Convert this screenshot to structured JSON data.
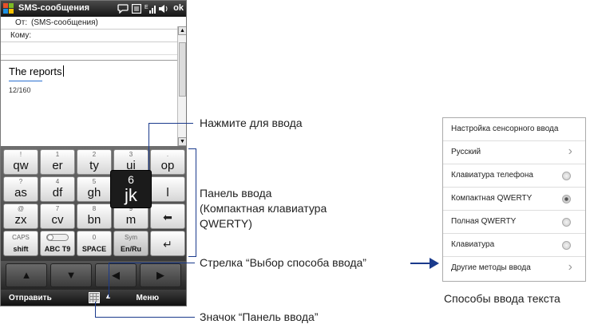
{
  "titlebar": {
    "title": "SMS-сообщения",
    "ok": "ok",
    "icons": [
      "windows-logo",
      "chat-icon",
      "contact-card-icon",
      "signal-icon",
      "speaker-icon"
    ]
  },
  "message": {
    "from_label": "От:",
    "from_value": "(SMS-сообщения)",
    "to_label": "Кому:",
    "to_value": "",
    "body": "The reports",
    "counter": "12/160"
  },
  "keyboard": {
    "row1": [
      {
        "top": "!",
        "main": "qw"
      },
      {
        "top": "1",
        "main": "er"
      },
      {
        "top": "2",
        "main": "ty"
      },
      {
        "top": "3",
        "main": "ui"
      },
      {
        "top": ".",
        "main": "op"
      }
    ],
    "row2": [
      {
        "top": "?",
        "main": "as"
      },
      {
        "top": "4",
        "main": "df"
      },
      {
        "top": "5",
        "main": "gh"
      },
      {
        "top": "",
        "main": "l"
      }
    ],
    "active_key": {
      "top": "6",
      "main": "jk"
    },
    "row3": [
      {
        "top": "@",
        "main": "zx"
      },
      {
        "top": "7",
        "main": "cv"
      },
      {
        "top": "8",
        "main": "bn"
      },
      {
        "top": "9",
        "main": "m"
      }
    ],
    "row4": [
      {
        "top": "CAPS",
        "main": "shift"
      },
      {
        "top": "",
        "main": "ABC T9"
      },
      {
        "top": "0",
        "main": "SPACE"
      },
      {
        "top": "Sym",
        "main": "En/Ru"
      }
    ],
    "backspace_icon": "backspace-arrow-icon",
    "enter_icon": "enter-icon"
  },
  "softkeys": {
    "left": "Отправить",
    "right": "Меню"
  },
  "callouts": {
    "tap": "Нажмите для ввода",
    "panel_line1": "Панель ввода",
    "panel_line2": "(Компактная клавиатура",
    "panel_line3": "QWERTY)",
    "arrow": "Стрелка “Выбор способа ввода”",
    "icon": "Значок “Панель ввода”"
  },
  "menu": {
    "items": [
      {
        "label": "Настройка сенсорного ввода",
        "control": "none"
      },
      {
        "label": "Русский",
        "control": "chevron"
      },
      {
        "label": "Клавиатура телефона",
        "control": "radio"
      },
      {
        "label": "Компактная QWERTY",
        "control": "radio-selected"
      },
      {
        "label": "Полная QWERTY",
        "control": "radio"
      },
      {
        "label": "Клавиатура",
        "control": "radio"
      },
      {
        "label": "Другие методы ввода",
        "control": "chevron"
      }
    ],
    "caption": "Способы ввода текста"
  },
  "colors": {
    "callout_line": "#1a3a8c",
    "titlebar": "#1e1e1e",
    "active_key": "#1b1b1b"
  }
}
